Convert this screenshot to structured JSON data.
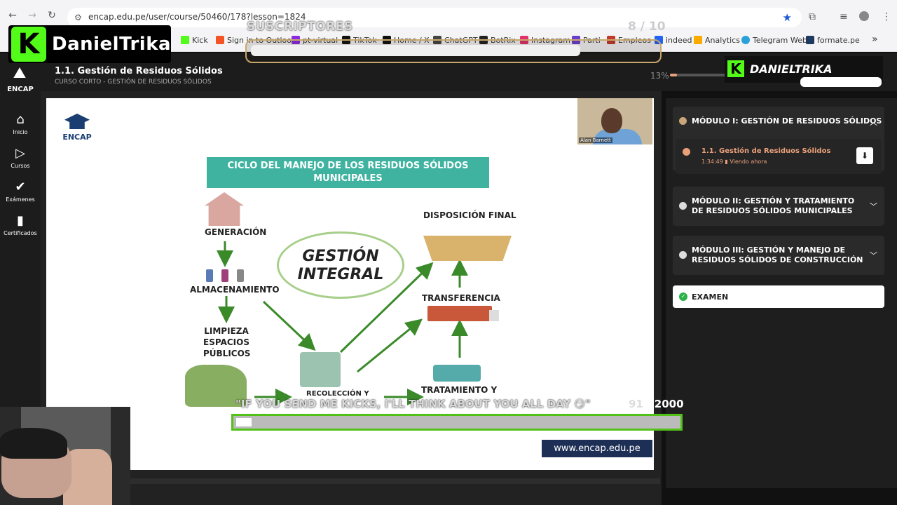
{
  "browser": {
    "url": "encap.edu.pe/user/course/50460/178?lesson=1824",
    "bookmarks": [
      {
        "label": "Kick",
        "color": "#53fc18"
      },
      {
        "label": "Sign in to Outlook",
        "color": "#f35325"
      },
      {
        "label": "pt-virtual",
        "color": "#8a2be2"
      },
      {
        "label": "TikTok",
        "color": "#111111"
      },
      {
        "label": "Home / X",
        "color": "#111111"
      },
      {
        "label": "ChatGPT",
        "color": "#444444"
      },
      {
        "label": "BotRix",
        "color": "#222222"
      },
      {
        "label": "Instagram",
        "color": "#e1306c"
      },
      {
        "label": "Parti",
        "color": "#6a3ccf"
      },
      {
        "label": "Empleos",
        "color": "#c0392b"
      },
      {
        "label": "indeed",
        "color": "#2164f3"
      },
      {
        "label": "Analytics",
        "color": "#f9ab00"
      },
      {
        "label": "Telegram Web",
        "color": "#2aa1da"
      },
      {
        "label": "formate.pe",
        "color": "#1e3a5f"
      }
    ]
  },
  "overlay": {
    "streamer": "DanielTrika",
    "streamer_italic": "DANIELTRIKA",
    "subs_label": "SUSCRIPTORES",
    "subs_count": "8 / 10",
    "kick_message": "\"IF YOU SEND ME KICKS, I'LL THINK ABOUT YOU ALL DAY 😏\"",
    "kick_current": "91",
    "kick_total": "/ 2000",
    "kick_progress": 0.0455
  },
  "sidebar": {
    "logo": "ENCAP",
    "items": [
      {
        "label": "Inicio",
        "icon": "home-icon"
      },
      {
        "label": "Cursos",
        "icon": "play-icon"
      },
      {
        "label": "Exámenes",
        "icon": "check-icon"
      },
      {
        "label": "Certificados",
        "icon": "bookmark-icon"
      }
    ]
  },
  "header": {
    "title": "1.1. Gestión de Residuos Sólidos",
    "subtitle": "CURSO CORTO - GESTIÓN DE RESIDUOS SÓLIDOS",
    "progress_label": "13%",
    "progress": 0.13
  },
  "slide": {
    "logo": "ENCAP",
    "webcam_name": "Alan Barnett",
    "title": "CICLO DEL MANEJO DE LOS RESIDUOS SÓLIDOS MUNICIPALES",
    "center": "GESTIÓN INTEGRAL",
    "labels": {
      "generacion": "GENERACIÓN",
      "almacenamiento": "ALMACENAMIENTO",
      "limpieza": "LIMPIEZA ESPACIOS PÚBLICOS",
      "recoleccion": "RECOLECCIÓN Y",
      "tratamiento": "TRATAMIENTO Y",
      "transferencia": "TRANSFERENCIA",
      "disposicion": "DISPOSICIÓN FINAL"
    },
    "url": "www.encap.edu.pe"
  },
  "modules": [
    {
      "title": "MÓDULO I: GESTIÓN DE RESIDUOS SÓLIDOS",
      "expanded": true
    },
    {
      "title": "MÓDULO II: GESTIÓN Y TRATAMIENTO DE RESIDUOS SÓLIDOS MUNICIPALES",
      "expanded": false
    },
    {
      "title": "MÓDULO III: GESTIÓN Y MANEJO DE RESIDUOS SÓLIDOS DE CONSTRUCCIÓN",
      "expanded": false
    }
  ],
  "lesson": {
    "name": "1.1. Gestión de Residuos Sólidos",
    "duration": "1:34:49",
    "status": "Viendo ahora"
  },
  "exam": {
    "label": "EXAMEN"
  }
}
